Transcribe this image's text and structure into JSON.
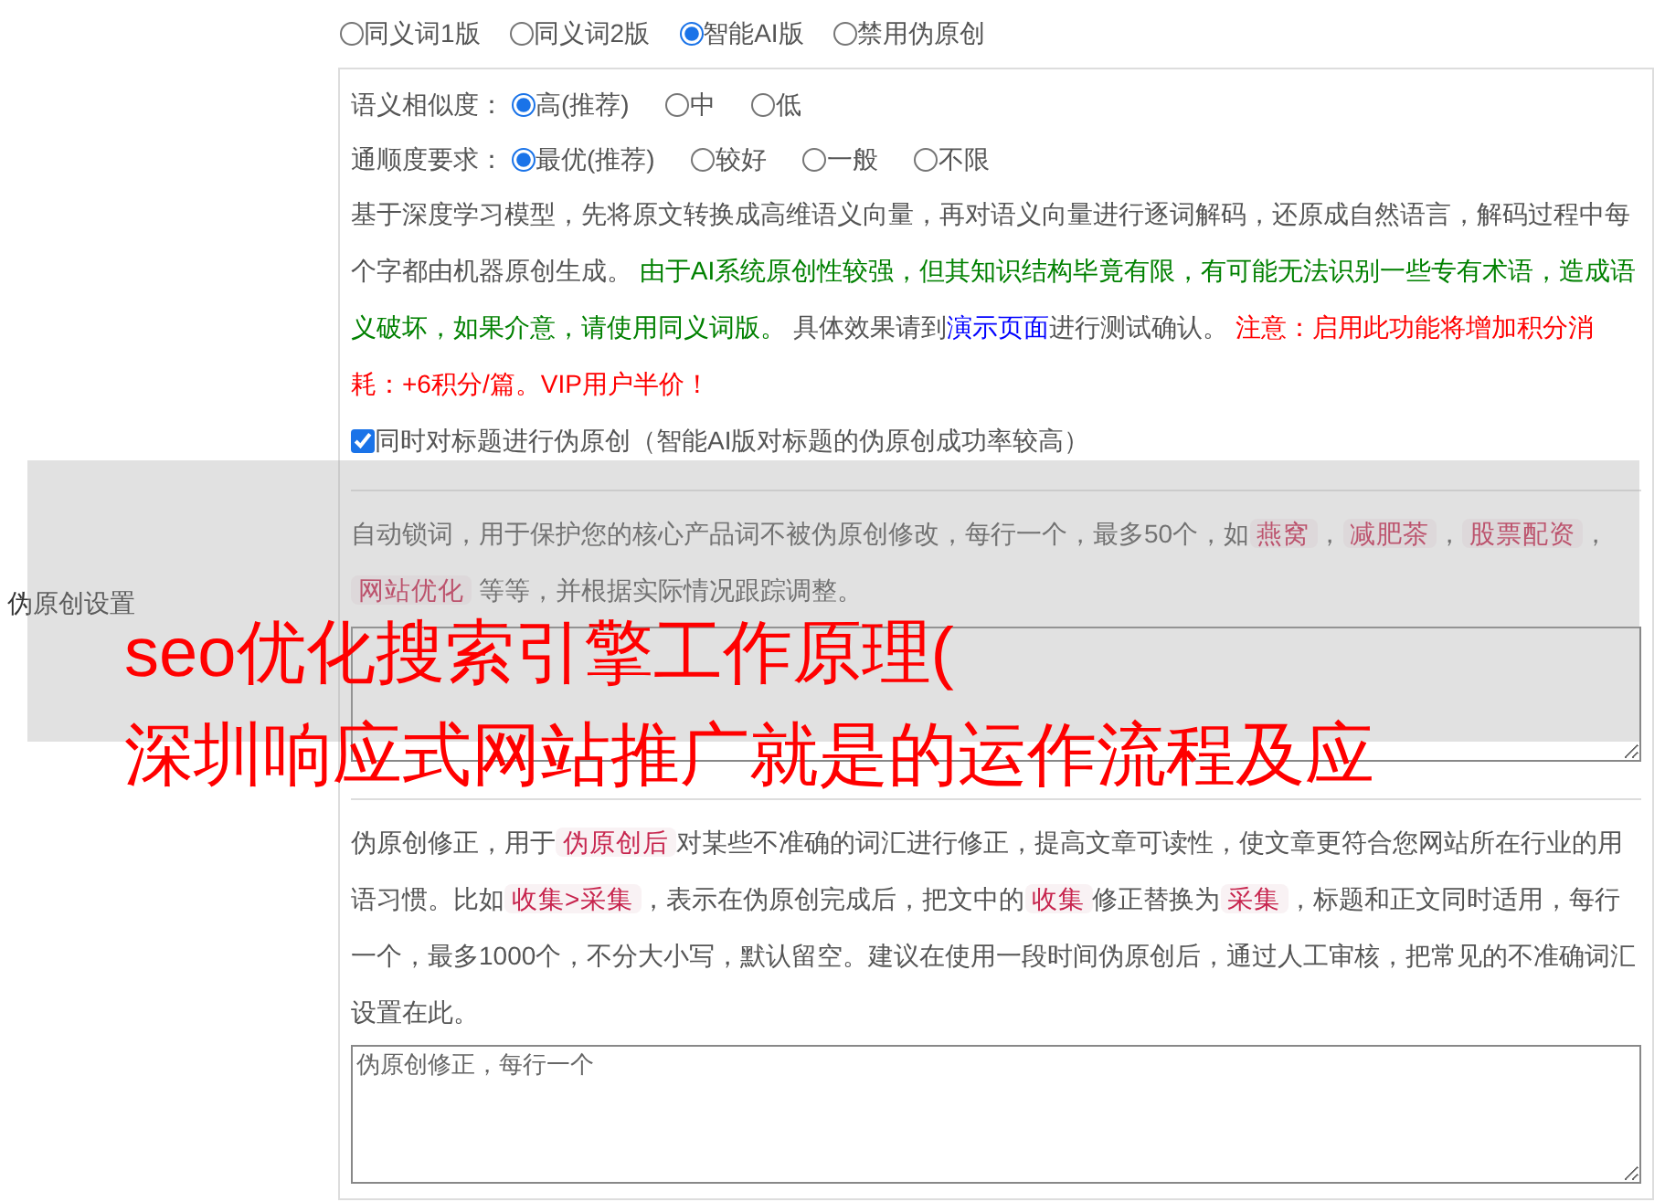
{
  "section_label": "伪原创设置",
  "mode_options": [
    {
      "label": "同义词1版",
      "selected": false
    },
    {
      "label": "同义词2版",
      "selected": false
    },
    {
      "label": "智能AI版",
      "selected": true
    },
    {
      "label": "禁用伪原创",
      "selected": false
    }
  ],
  "similarity": {
    "label": "语义相似度：",
    "options": [
      {
        "label": "高(推荐)",
        "selected": true
      },
      {
        "label": "中",
        "selected": false
      },
      {
        "label": "低",
        "selected": false
      }
    ]
  },
  "fluency": {
    "label": "通顺度要求：",
    "options": [
      {
        "label": "最优(推荐)",
        "selected": true
      },
      {
        "label": "较好",
        "selected": false
      },
      {
        "label": "一般",
        "selected": false
      },
      {
        "label": "不限",
        "selected": false
      }
    ]
  },
  "ai_description": [
    {
      "kind": "plain",
      "text": "基于深度学习模型，先将原文转换成高维语义向量，再对语义向量进行逐词解码，还原成自然语言，解码过程中每个字都由机器原创生成。 "
    },
    {
      "kind": "green",
      "text": "由于AI系统原创性较强，但其知识结构毕竟有限，有可能无法识别一些专有术语，造成语义破坏，如果介意，请使用同义词版。"
    },
    {
      "kind": "plain",
      "text": " 具体效果请到"
    },
    {
      "kind": "link",
      "text": "演示页面"
    },
    {
      "kind": "plain",
      "text": "进行测试确认。 "
    },
    {
      "kind": "red",
      "text": "注意：启用此功能将增加积分消耗：+6积分/篇。VIP用户半价！"
    }
  ],
  "title_option": {
    "label": "同时对标题进行伪原创（智能AI版对标题的伪原创成功率较高）",
    "checked": true
  },
  "lock_words": {
    "description": [
      {
        "kind": "plain",
        "text": "自动锁词，用于保护您的核心产品词不被伪原创修改，每行一个，最多50个，如"
      },
      {
        "kind": "tag",
        "text": "燕窝"
      },
      {
        "kind": "plain",
        "text": "，"
      },
      {
        "kind": "tag",
        "text": "减肥茶"
      },
      {
        "kind": "plain",
        "text": "，"
      },
      {
        "kind": "tag",
        "text": "股票配资"
      },
      {
        "kind": "plain",
        "text": "，"
      },
      {
        "kind": "tag",
        "text": "网站优化"
      },
      {
        "kind": "plain",
        "text": " 等等，并根据实际情况跟踪调整。"
      }
    ]
  },
  "correction": {
    "description": [
      {
        "kind": "plain",
        "text": "伪原创修正，用于"
      },
      {
        "kind": "tag",
        "text": "伪原创后"
      },
      {
        "kind": "plain",
        "text": "对某些不准确的词汇进行修正，提高文章可读性，使文章更符合您网站所在行业的用语习惯。比如"
      },
      {
        "kind": "tag",
        "text": "收集>采集"
      },
      {
        "kind": "plain",
        "text": "，表示在伪原创完成后，把文中的"
      },
      {
        "kind": "tag",
        "text": "收集"
      },
      {
        "kind": "plain",
        "text": "修正替换为"
      },
      {
        "kind": "tag",
        "text": "采集"
      },
      {
        "kind": "plain",
        "text": "，标题和正文同时适用，每行一个，最多1000个，不分大小写，默认留空。建议在使用一段时间伪原创后，通过人工审核，把常见的不准确词汇设置在此。"
      }
    ],
    "placeholder": "伪原创修正，每行一个"
  },
  "overlay_title": [
    "seo优化搜索引擎工作原理(",
    "深圳响应式网站推广就是的运作流程及应"
  ]
}
